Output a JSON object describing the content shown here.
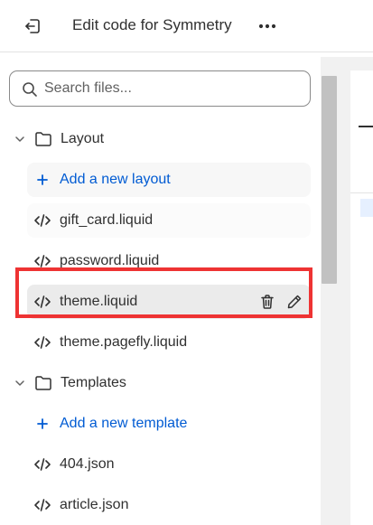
{
  "header": {
    "title": "Edit code for Symmetry",
    "back_icon": "exit-icon",
    "more_icon": "more-horizontal-icon"
  },
  "search": {
    "placeholder": "Search files...",
    "value": ""
  },
  "tree": {
    "layout_folder": "Layout",
    "add_layout": "Add a new layout",
    "layout_files": [
      "gift_card.liquid",
      "password.liquid",
      "theme.liquid",
      "theme.pagefly.liquid"
    ],
    "templates_folder": "Templates",
    "add_template": "Add a new template",
    "template_files": [
      "404.json",
      "article.json"
    ]
  },
  "colors": {
    "accent": "#005bd3",
    "highlight": "#ee3333",
    "selected_row": "#ebebeb"
  }
}
